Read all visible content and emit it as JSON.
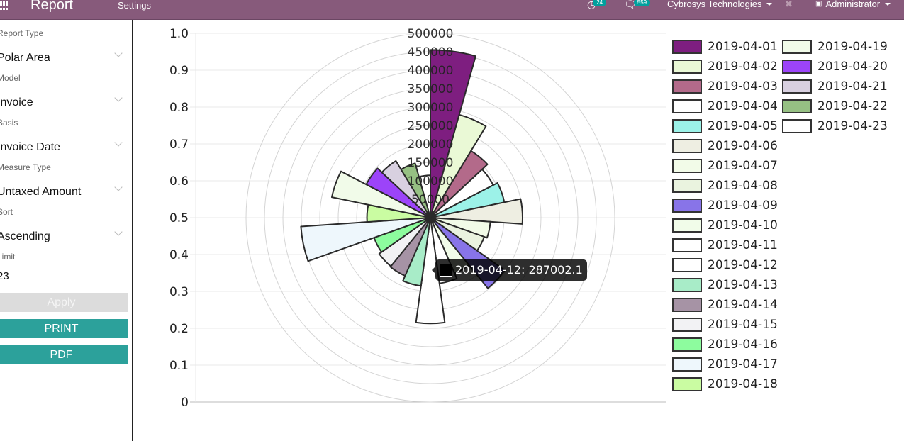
{
  "topbar": {
    "app_title": "Report",
    "menu_settings": "Settings",
    "activity_count": "24",
    "messages_count": "559",
    "company": "Cybrosys Technologies",
    "user": "Administrator"
  },
  "sidebar": {
    "fields": [
      {
        "label": "Report Type",
        "value": "Polar Area"
      },
      {
        "label": "Model",
        "value": "Invoice"
      },
      {
        "label": "Basis",
        "value": "Invoice Date"
      },
      {
        "label": "Measure Type",
        "value": "Untaxed Amount"
      },
      {
        "label": "Sort",
        "value": "Ascending"
      }
    ],
    "limit_label": "Limit",
    "limit_value": "23",
    "apply_label": "Apply",
    "print_label": "PRINT",
    "pdf_label": "PDF"
  },
  "tooltip": {
    "text": "2019-04-12: 287002.1",
    "swatch_color": "#000000"
  },
  "chart_data": {
    "type": "polarArea",
    "title": "",
    "categories": [
      "2019-04-01",
      "2019-04-02",
      "2019-04-03",
      "2019-04-04",
      "2019-04-05",
      "2019-04-06",
      "2019-04-07",
      "2019-04-08",
      "2019-04-09",
      "2019-04-10",
      "2019-04-11",
      "2019-04-12",
      "2019-04-13",
      "2019-04-14",
      "2019-04-15",
      "2019-04-16",
      "2019-04-17",
      "2019-04-18",
      "2019-04-19",
      "2019-04-20",
      "2019-04-21",
      "2019-04-22",
      "2019-04-23"
    ],
    "values": [
      455000,
      290000,
      212000,
      192000,
      205000,
      250000,
      163000,
      155000,
      247000,
      165000,
      180000,
      287002.1,
      187000,
      172000,
      170000,
      162000,
      352000,
      172000,
      273000,
      196000,
      180000,
      153000,
      115000
    ],
    "colors": [
      "#7e1e80",
      "#eaf9d6",
      "#b36a8a",
      "#ffffff",
      "#9cf2e8",
      "#eeeee2",
      "#f2fbe8",
      "#eaf3df",
      "#8874e8",
      "#f1fce9",
      "#ffffff",
      "#ffffff",
      "#a8ecc8",
      "#a693a5",
      "#f2f2f4",
      "#8dfc9e",
      "#eef7fc",
      "#cafca2",
      "#f1fbe9",
      "#9c44f9",
      "#d8d0e0",
      "#96c083",
      "#ffffff"
    ],
    "radial_ticks": [
      50000,
      100000,
      150000,
      200000,
      250000,
      300000,
      350000,
      400000,
      450000,
      500000
    ],
    "radial_range": [
      0,
      500000
    ],
    "yaxis_ticks": [
      "0",
      "0.1",
      "0.2",
      "0.3",
      "0.4",
      "0.5",
      "0.6",
      "0.7",
      "0.8",
      "0.9",
      "1.0"
    ],
    "legend_position": "right",
    "grid": true
  }
}
